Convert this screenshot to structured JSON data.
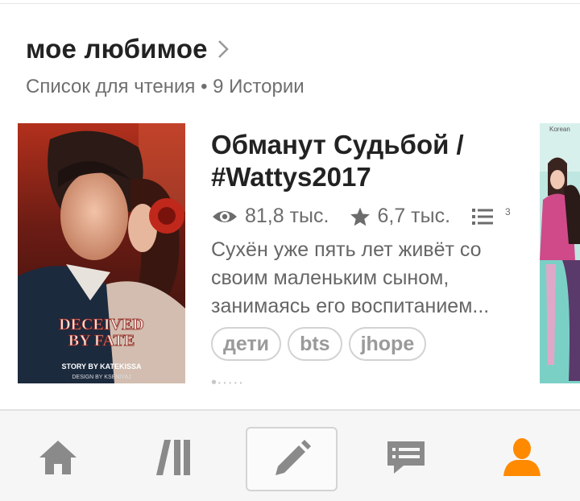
{
  "reading_list": {
    "title": "мое любимое",
    "subtitle": "Список для чтения • 9 Истории"
  },
  "book": {
    "title": "Обманут Судьбой / #Wattys2017",
    "reads": "81,8 тыс.",
    "votes": "6,7 тыс.",
    "parts": "3",
    "description": "Сухён уже пять лет живёт со своим маленьким сыном, занимаясь его воспитанием...",
    "tags": [
      "дети",
      "bts",
      "jhope"
    ],
    "cover": {
      "title_line1": "DECEIVED",
      "title_line2": "BY FATE",
      "story_by": "STORY BY KATEKISSA",
      "design_by": "DESIGN BY KSENIYAJ"
    }
  },
  "next_cover": {
    "label": "Korean"
  },
  "nav": {
    "items": [
      {
        "name": "home",
        "icon": "home-icon"
      },
      {
        "name": "library",
        "icon": "library-icon"
      },
      {
        "name": "write",
        "icon": "pencil-icon"
      },
      {
        "name": "messages",
        "icon": "chat-icon"
      },
      {
        "name": "profile",
        "icon": "person-icon",
        "active": true
      }
    ]
  },
  "colors": {
    "accent": "#FF8A00",
    "icon_gray": "#8a8a8a",
    "text_dark": "#222222",
    "text_gray": "#6c6c6c"
  }
}
